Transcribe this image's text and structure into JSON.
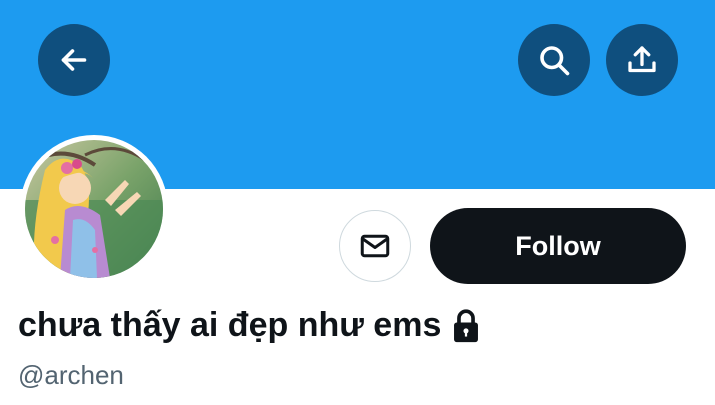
{
  "header": {
    "back_icon": "arrow-left-icon",
    "search_icon": "search-icon",
    "share_icon": "share-icon"
  },
  "profile": {
    "display_name": "chưa thấy ai đẹp như ems",
    "handle": "@archen",
    "protected_icon": "lock-icon",
    "avatar": "avatar"
  },
  "actions": {
    "message_icon": "mail-icon",
    "follow_label": "Follow"
  },
  "colors": {
    "banner": "#1d9bf0",
    "header_button": "#0f4f7e",
    "follow_button": "#0f1419",
    "handle_text": "#536471"
  }
}
